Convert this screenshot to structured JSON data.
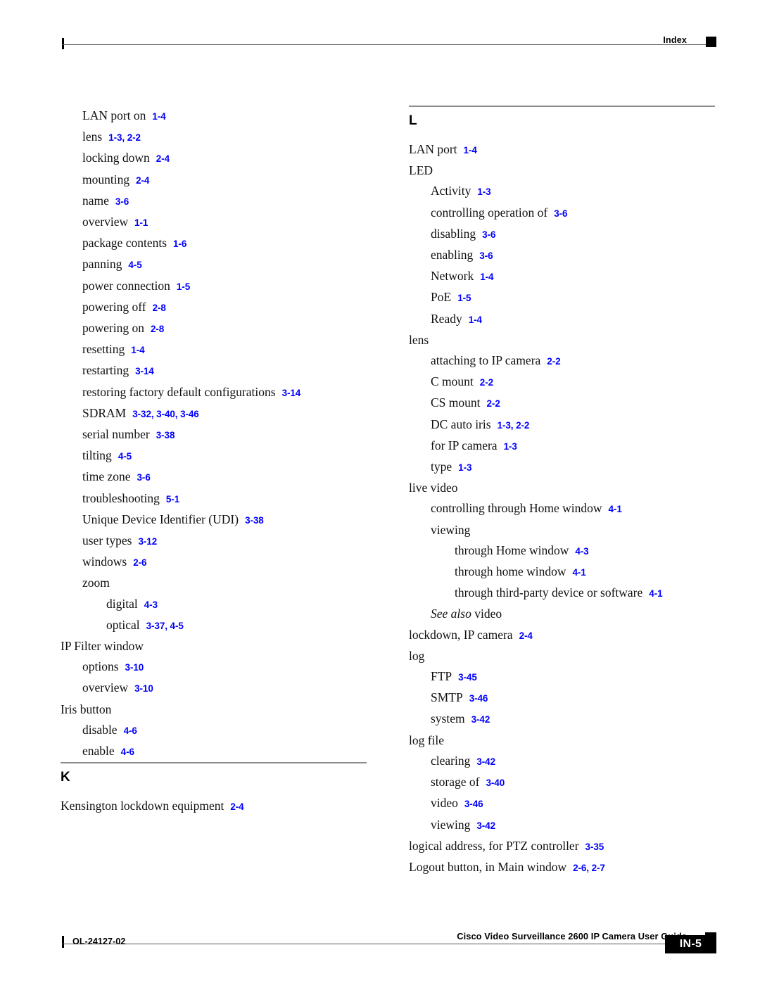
{
  "header": {
    "label": "Index",
    "marker": "black-square"
  },
  "columns": {
    "left": {
      "continued_entries": [
        {
          "level": 1,
          "term": "LAN port on",
          "pages": "1-4"
        },
        {
          "level": 1,
          "term": "lens",
          "pages": "1-3, 2-2"
        },
        {
          "level": 1,
          "term": "locking down",
          "pages": "2-4"
        },
        {
          "level": 1,
          "term": "mounting",
          "pages": "2-4"
        },
        {
          "level": 1,
          "term": "name",
          "pages": "3-6"
        },
        {
          "level": 1,
          "term": "overview",
          "pages": "1-1"
        },
        {
          "level": 1,
          "term": "package contents",
          "pages": "1-6"
        },
        {
          "level": 1,
          "term": "panning",
          "pages": "4-5"
        },
        {
          "level": 1,
          "term": "power connection",
          "pages": "1-5"
        },
        {
          "level": 1,
          "term": "powering off",
          "pages": "2-8"
        },
        {
          "level": 1,
          "term": "powering on",
          "pages": "2-8"
        },
        {
          "level": 1,
          "term": "resetting",
          "pages": "1-4"
        },
        {
          "level": 1,
          "term": "restarting",
          "pages": "3-14"
        },
        {
          "level": 1,
          "term": "restoring factory default configurations",
          "pages": "3-14"
        },
        {
          "level": 1,
          "term": "SDRAM",
          "pages": "3-32, 3-40, 3-46"
        },
        {
          "level": 1,
          "term": "serial number",
          "pages": "3-38"
        },
        {
          "level": 1,
          "term": "tilting",
          "pages": "4-5"
        },
        {
          "level": 1,
          "term": "time zone",
          "pages": "3-6"
        },
        {
          "level": 1,
          "term": "troubleshooting",
          "pages": "5-1"
        },
        {
          "level": 1,
          "term": "Unique Device Identifier (UDI)",
          "pages": "3-38"
        },
        {
          "level": 1,
          "term": "user types",
          "pages": "3-12"
        },
        {
          "level": 1,
          "term": "windows",
          "pages": "2-6"
        },
        {
          "level": 1,
          "term": "zoom",
          "pages": ""
        },
        {
          "level": 2,
          "term": "digital",
          "pages": "4-3"
        },
        {
          "level": 2,
          "term": "optical",
          "pages": "3-37, 4-5"
        },
        {
          "level": 0,
          "term": "IP Filter window",
          "pages": ""
        },
        {
          "level": 1,
          "term": "options",
          "pages": "3-10"
        },
        {
          "level": 1,
          "term": "overview",
          "pages": "3-10"
        },
        {
          "level": 0,
          "term": "Iris button",
          "pages": ""
        },
        {
          "level": 1,
          "term": "disable",
          "pages": "4-6"
        },
        {
          "level": 1,
          "term": "enable",
          "pages": "4-6"
        }
      ],
      "section": {
        "letter": "K",
        "entries": [
          {
            "level": 0,
            "term": "Kensington lockdown equipment",
            "pages": "2-4"
          }
        ]
      }
    },
    "right": {
      "section": {
        "letter": "L",
        "entries": [
          {
            "level": 0,
            "term": "LAN port",
            "pages": "1-4"
          },
          {
            "level": 0,
            "term": "LED",
            "pages": ""
          },
          {
            "level": 1,
            "term": "Activity",
            "pages": "1-3"
          },
          {
            "level": 1,
            "term": "controlling operation of",
            "pages": "3-6"
          },
          {
            "level": 1,
            "term": "disabling",
            "pages": "3-6"
          },
          {
            "level": 1,
            "term": "enabling",
            "pages": "3-6"
          },
          {
            "level": 1,
            "term": "Network",
            "pages": "1-4"
          },
          {
            "level": 1,
            "term": "PoE",
            "pages": "1-5"
          },
          {
            "level": 1,
            "term": "Ready",
            "pages": "1-4"
          },
          {
            "level": 0,
            "term": "lens",
            "pages": ""
          },
          {
            "level": 1,
            "term": "attaching to IP camera",
            "pages": "2-2"
          },
          {
            "level": 1,
            "term": "C mount",
            "pages": "2-2"
          },
          {
            "level": 1,
            "term": "CS mount",
            "pages": "2-2"
          },
          {
            "level": 1,
            "term": "DC auto iris",
            "pages": "1-3, 2-2"
          },
          {
            "level": 1,
            "term": "for IP camera",
            "pages": "1-3"
          },
          {
            "level": 1,
            "term": "type",
            "pages": "1-3"
          },
          {
            "level": 0,
            "term": "live video",
            "pages": ""
          },
          {
            "level": 1,
            "term": "controlling through Home window",
            "pages": "4-1"
          },
          {
            "level": 1,
            "term": "viewing",
            "pages": ""
          },
          {
            "level": 2,
            "term": "through Home window",
            "pages": "4-3"
          },
          {
            "level": 2,
            "term": "through home window",
            "pages": "4-1"
          },
          {
            "level": 2,
            "term": "through third-party device or software",
            "pages": "4-1"
          },
          {
            "level": 1,
            "term": "See also video",
            "pages": "",
            "see_also_prefix": "See also",
            "see_also_target": "video"
          },
          {
            "level": 0,
            "term": "lockdown, IP camera",
            "pages": "2-4"
          },
          {
            "level": 0,
            "term": "log",
            "pages": ""
          },
          {
            "level": 1,
            "term": "FTP",
            "pages": "3-45"
          },
          {
            "level": 1,
            "term": "SMTP",
            "pages": "3-46"
          },
          {
            "level": 1,
            "term": "system",
            "pages": "3-42"
          },
          {
            "level": 0,
            "term": "log file",
            "pages": ""
          },
          {
            "level": 1,
            "term": "clearing",
            "pages": "3-42"
          },
          {
            "level": 1,
            "term": "storage of",
            "pages": "3-40"
          },
          {
            "level": 1,
            "term": "video",
            "pages": "3-46"
          },
          {
            "level": 1,
            "term": "viewing",
            "pages": "3-42"
          },
          {
            "level": 0,
            "term": "logical address, for PTZ controller",
            "pages": "3-35"
          },
          {
            "level": 0,
            "term": "Logout button, in Main window",
            "pages": "2-6, 2-7"
          }
        ]
      }
    }
  },
  "footer": {
    "doc_id": "OL-24127-02",
    "title": "Cisco Video Surveillance 2600 IP Camera User Guide",
    "page_number": "IN-5",
    "marker": "black-square"
  },
  "colors": {
    "page_reference": "#0000FF",
    "rule": "#8c8c8c",
    "text": "#111111"
  }
}
